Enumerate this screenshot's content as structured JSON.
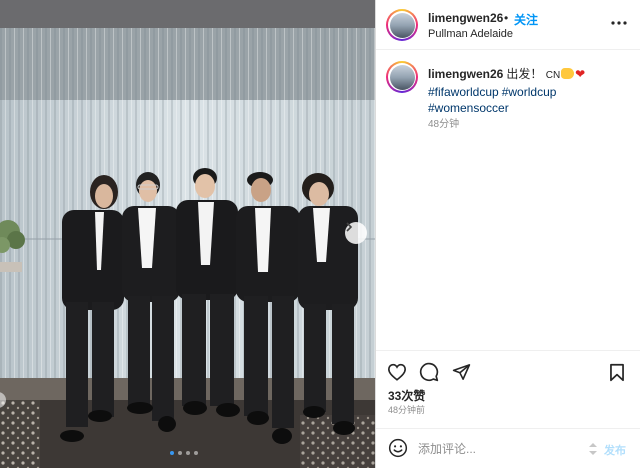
{
  "post": {
    "username": "limengwen26",
    "separator": "•",
    "follow_label": "关注",
    "location": "Pullman Adelaide",
    "more_icon": "more-horizontal-icon"
  },
  "caption": {
    "username": "limengwen26",
    "text": "出发！",
    "country": "CN",
    "emojis": [
      "fist-bump-emoji",
      "red-heart-emoji"
    ],
    "hashtags": [
      "#fifaworldcup",
      "#worldcup",
      "#womensoccer"
    ],
    "time": "48分钟"
  },
  "actions": {
    "icons": [
      "heart-icon",
      "comment-icon",
      "share-icon",
      "bookmark-icon"
    ],
    "likes": "33次赞",
    "time": "48分钟前"
  },
  "comment": {
    "placeholder": "添加评论...",
    "post_label": "发布"
  },
  "carousel": {
    "slides": 4,
    "active_index": 0
  },
  "colors": {
    "follow_blue": "#0095f6",
    "hashtag": "#00376b",
    "muted": "#8e8e8e",
    "heart_red": "#e02424"
  }
}
